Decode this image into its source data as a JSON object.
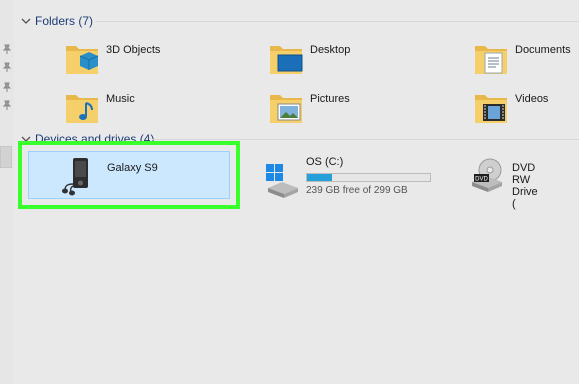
{
  "folders_section": {
    "label": "Folders (7)"
  },
  "folders": [
    {
      "label": "3D Objects",
      "icon": "3d-objects-folder-icon"
    },
    {
      "label": "Desktop",
      "icon": "desktop-folder-icon"
    },
    {
      "label": "Documents",
      "icon": "documents-folder-icon"
    },
    {
      "label": "Music",
      "icon": "music-folder-icon"
    },
    {
      "label": "Pictures",
      "icon": "pictures-folder-icon"
    },
    {
      "label": "Videos",
      "icon": "videos-folder-icon"
    }
  ],
  "devices_section": {
    "label": "Devices and drives (4)"
  },
  "devices": [
    {
      "label": "Galaxy S9",
      "icon": "media-player-icon",
      "selected": true
    },
    {
      "label": "OS (C:)",
      "icon": "windows-drive-icon",
      "free_text": "239 GB free of 299 GB",
      "used_fraction": 0.2
    },
    {
      "label": "DVD RW Drive (",
      "icon": "dvd-drive-icon"
    }
  ],
  "colors": {
    "highlight_border": "#39ff2a",
    "selection_fill": "#cce8ff",
    "header_text": "#1f3c78",
    "usage_bar": "#26a0da"
  }
}
